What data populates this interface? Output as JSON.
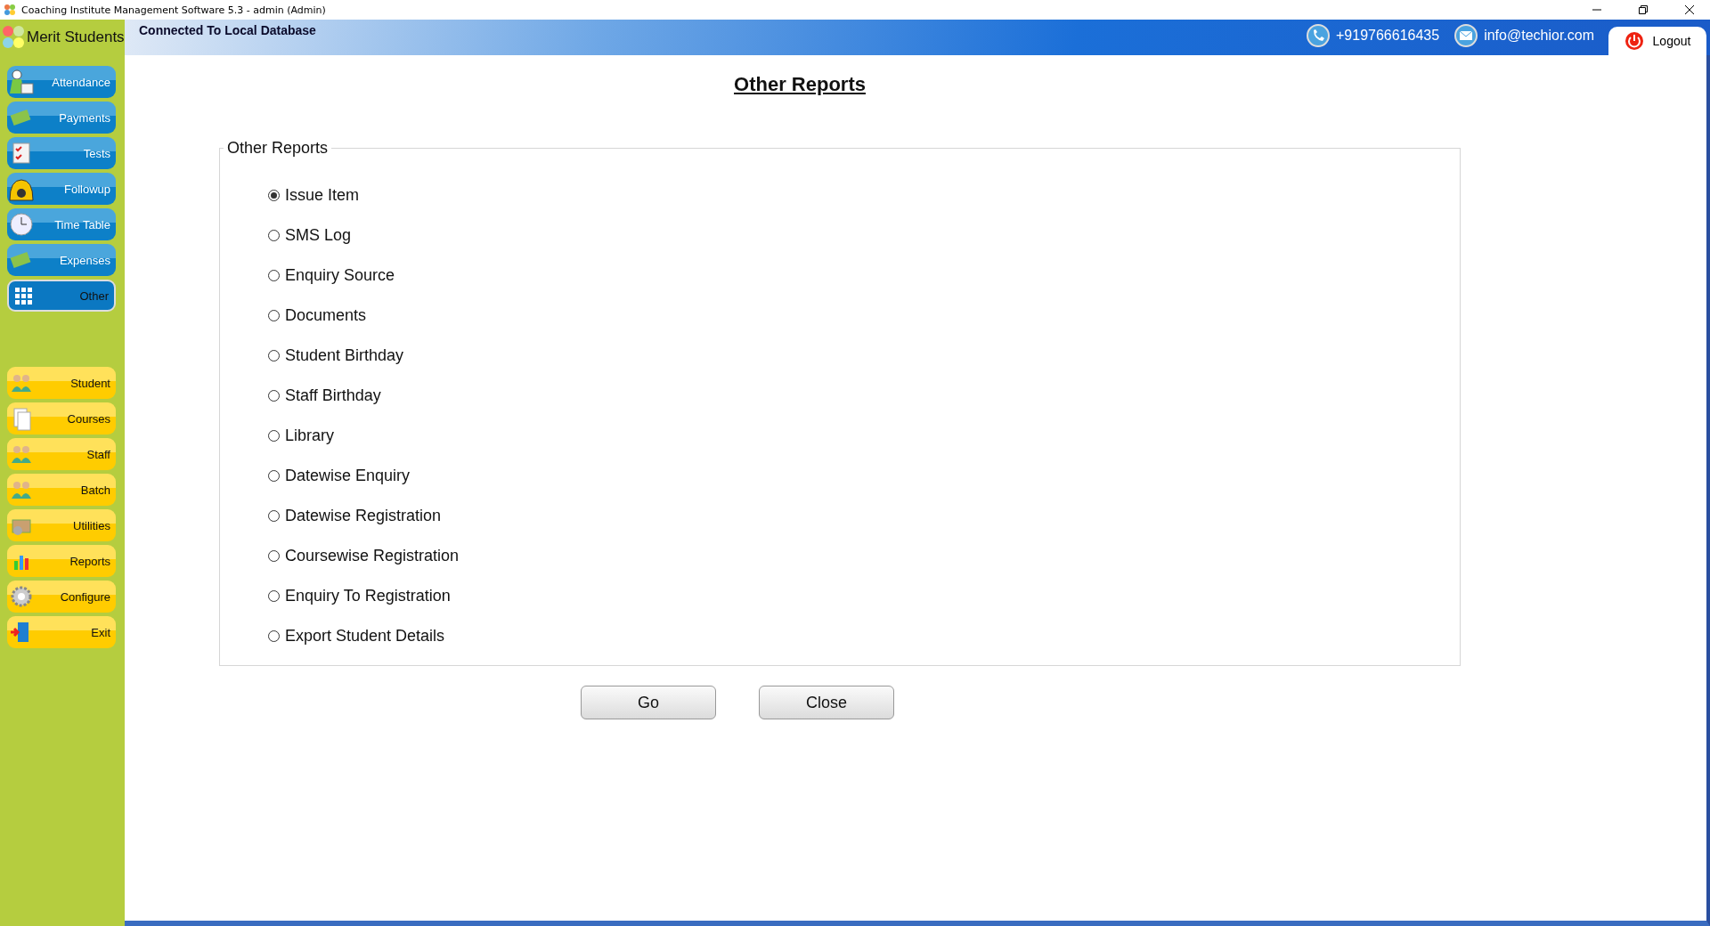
{
  "window": {
    "title": "Coaching Institute Management Software 5.3  -  admin (Admin)"
  },
  "brand": {
    "name": "Merit Students"
  },
  "header": {
    "connection": "Connected To  Local Database",
    "phone": "+919766616435",
    "email": "info@techior.com",
    "logout": "Logout"
  },
  "sidebar": {
    "primary": [
      {
        "label": "Attendance",
        "selected": false
      },
      {
        "label": "Payments",
        "selected": false
      },
      {
        "label": "Tests",
        "selected": false
      },
      {
        "label": "Followup",
        "selected": false
      },
      {
        "label": "Time Table",
        "selected": false
      },
      {
        "label": "Expenses",
        "selected": false
      },
      {
        "label": "Other",
        "selected": true
      }
    ],
    "secondary": [
      {
        "label": "Student"
      },
      {
        "label": "Courses"
      },
      {
        "label": "Staff"
      },
      {
        "label": "Batch"
      },
      {
        "label": "Utilities"
      },
      {
        "label": "Reports"
      },
      {
        "label": "Configure"
      },
      {
        "label": "Exit"
      }
    ]
  },
  "page": {
    "title": "Other Reports",
    "group_label": "Other Reports",
    "options": [
      {
        "label": "Issue Item",
        "selected": true
      },
      {
        "label": "SMS Log",
        "selected": false
      },
      {
        "label": "Enquiry Source",
        "selected": false
      },
      {
        "label": "Documents",
        "selected": false
      },
      {
        "label": "Student Birthday",
        "selected": false
      },
      {
        "label": "Staff Birthday",
        "selected": false
      },
      {
        "label": "Library",
        "selected": false
      },
      {
        "label": "Datewise Enquiry",
        "selected": false
      },
      {
        "label": "Datewise Registration",
        "selected": false
      },
      {
        "label": "Coursewise Registration",
        "selected": false
      },
      {
        "label": "Enquiry To Registration",
        "selected": false
      },
      {
        "label": "Export Student Details",
        "selected": false
      }
    ],
    "buttons": [
      "Go",
      "Close"
    ]
  }
}
